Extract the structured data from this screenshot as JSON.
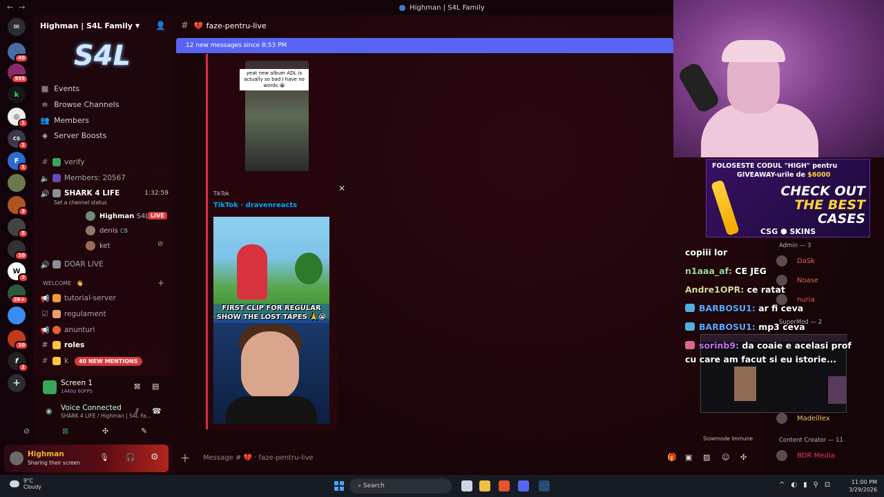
{
  "window": {
    "title": "Highman | S4L Family"
  },
  "server": {
    "name": "Highman | S4L Family",
    "logo_text": "S4L",
    "menu": [
      {
        "label": "Events",
        "icon": "calendar-icon"
      },
      {
        "label": "Browse Channels",
        "icon": "browse-icon"
      },
      {
        "label": "Members",
        "icon": "members-icon"
      },
      {
        "label": "Server Boosts",
        "icon": "boost-icon"
      }
    ]
  },
  "rail": {
    "badges": [
      "40",
      "555",
      "1",
      "1",
      "1",
      "3",
      "5",
      "1",
      "10",
      "2",
      "2K+",
      "10",
      "1"
    ]
  },
  "channels": {
    "verify": "verify",
    "members_count": "Members: 20567",
    "shark": "SHARK 4 LIFE",
    "shark_time": "1:32:59",
    "channel_status": "Set a channel status",
    "vc_users": [
      {
        "name": "Highman",
        "tag": "S4L"
      },
      {
        "name": "denis",
        "tag": "CB"
      },
      {
        "name": "ket",
        "tag": ""
      }
    ],
    "live_label": "LIVE",
    "doar_live": "DOAR LIVE",
    "welcome_category": "WELCOME · 👋",
    "tutorial": "tutorial-server",
    "regulament": "regulament",
    "anunturi": "anunturi",
    "roles": "roles",
    "partial": "k",
    "mentions_pill": "40 NEW MENTIONS"
  },
  "stream_panel": {
    "title": "Screen 1",
    "quality": "1440p 60FPS"
  },
  "voice_panel": {
    "status": "Voice Connected",
    "location": "SHARK 4 LIFE / Highman | S4L Fa..."
  },
  "user_panel": {
    "name": "Highman",
    "status": "Sharing their screen"
  },
  "chat": {
    "channel": "faze-pentru-live",
    "new_messages": "12 new messages since 8:53 PM",
    "video1_caption": "yeat new album ADL is actually so bad I have no words 😭",
    "embed_source": "TikTok",
    "embed_title": "TikTok · dravenreacts",
    "video2_banner": "FIRST CLIP FOR REGULAR SHOW THE LOST TAPES 🙏😭",
    "composer_placeholder": "Message # 💔 · faze-pentru-live",
    "slowmode": "Slowmode Immune"
  },
  "ad": {
    "line1": "FOLOSESTE CODUL \"HIGH\" pentru",
    "line2_prefix": "GIVEAWAY-urile de ",
    "line2_amount": "$6000",
    "big1": "CHECK OUT",
    "big2": "THE BEST",
    "big3": "CASES",
    "brand": "CSG ⬢ SKINS"
  },
  "overlay_chat": [
    {
      "user": "",
      "msg": "copiii lor"
    },
    {
      "user": "n1aaa_af:",
      "msg": "CE JEG"
    },
    {
      "user": "Andre1OPR:",
      "msg": "ce ratat"
    },
    {
      "user": "BARBOSU1:",
      "msg": "ar fi ceva"
    },
    {
      "user": "BARBOSU1:",
      "msg": "mp3 ceva"
    },
    {
      "user": "sorinb9:",
      "msg": "da coaie e acelasi prof"
    },
    {
      "user": "",
      "msg": "cu care am facut si eu istorie..."
    }
  ],
  "member_list": {
    "admin_header": "Admin — 3",
    "admins": [
      "DaSk",
      "Noase",
      "nuria"
    ],
    "supermod_header": "SuperMod — 2",
    "supermod_visible": "Madeillex",
    "creator_header": "Content Creator — 11",
    "creators": [
      "BDR Media"
    ]
  },
  "taskbar": {
    "temp": "9°C",
    "weather": "Cloudy",
    "search": "Search",
    "time": "11:00 PM",
    "date": "3/29/2026"
  }
}
